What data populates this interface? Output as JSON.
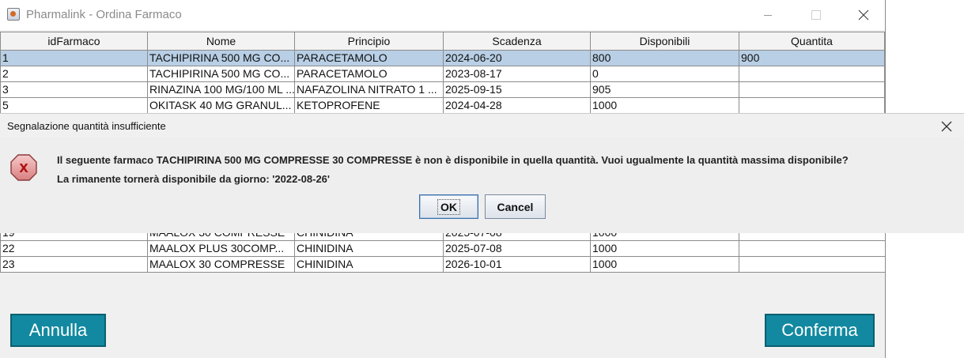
{
  "window": {
    "title": "Pharmalink - Ordina Farmaco"
  },
  "table": {
    "columns": [
      "idFarmaco",
      "Nome",
      "Principio",
      "Scadenza",
      "Disponibili",
      "Quantita"
    ],
    "rows_top": [
      [
        "1",
        "TACHIPIRINA 500 MG CO...",
        "PARACETAMOLO",
        "2024-06-20",
        "800",
        "900"
      ],
      [
        "2",
        "TACHIPIRINA 500 MG CO...",
        "PARACETAMOLO",
        "2023-08-17",
        "0",
        ""
      ],
      [
        "3",
        "RINAZINA 100 MG/100 ML ...",
        "NAFAZOLINA NITRATO 1 ...",
        "2025-09-15",
        "905",
        ""
      ],
      [
        "5",
        "OKITASK 40 MG GRANUL...",
        "KETOPROFENE",
        "2024-04-28",
        "1000",
        ""
      ]
    ],
    "rows_bottom": [
      [
        "19",
        "MAALOX 30 COMPRESSE",
        "CHINIDINA",
        "2025-07-08",
        "1000",
        ""
      ],
      [
        "22",
        "MAALOX PLUS 30COMP...",
        "CHINIDINA",
        "2025-07-08",
        "1000",
        ""
      ],
      [
        "23",
        "MAALOX 30 COMPRESSE",
        "CHINIDINA",
        "2026-10-01",
        "1000",
        ""
      ]
    ],
    "selected_row_color": "#b8cfe5"
  },
  "buttons": {
    "annulla": "Annulla",
    "conferma": "Conferma",
    "accent": "#1289a0"
  },
  "dialog": {
    "title": "Segnalazione quantità insufficiente",
    "icon": "error-icon",
    "message_line1": "Il seguente farmaco TACHIPIRINA 500 MG COMPRESSE 30 COMPRESSE è non è disponibile in quella quantità. Vuoi ugualmente la quantità massima disponibile?",
    "message_line2": "La rimanente tornerà disponibile da giorno: '2022-08-26'",
    "ok_label": "OK",
    "cancel_label": "Cancel"
  }
}
